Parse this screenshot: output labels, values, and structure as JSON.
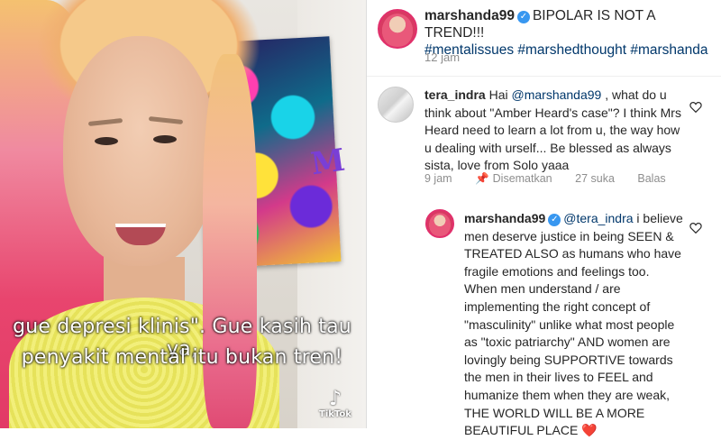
{
  "video": {
    "caption_line1": "gue depresi klinis\". Gue kasih tau ya,",
    "caption_line2": "penyakit mental itu bukan tren!",
    "watermark": "TikTok",
    "painting_letter": "M"
  },
  "post": {
    "username": "marshanda99",
    "text": "BIPOLAR IS NOT A TREND!!!",
    "hashtags": "#mentalissues #marshedthought #marshanda",
    "time": "12 jam"
  },
  "comments": [
    {
      "username": "tera_indra",
      "prefix": "Hai ",
      "mention": "@marshanda99",
      "text": " , what do u think about \"Amber Heard's case\"? I think Mrs Heard need to learn a lot from u, the way how u dealing with urself... Be blessed as always sista, love from Solo yaaa",
      "time": "9 jam",
      "pinned_label": "Disematkan",
      "likes": "27 suka",
      "reply_label": "Balas"
    },
    {
      "username": "marshanda99",
      "mention": "@tera_indra",
      "text": " i believe men deserve justice in being SEEN & TREATED ALSO as humans who have fragile emotions and feelings too. When men understand / are implementing the right concept of \"masculinity\" unlike what most people  as \"toxic patriarchy\" AND  women are lovingly being SUPPORTIVE towards the men in their lives to FEEL and humanize them when they are weak, THE WORLD WILL BE A MORE BEAUTIFUL PLACE",
      "emoji": "❤️"
    }
  ]
}
